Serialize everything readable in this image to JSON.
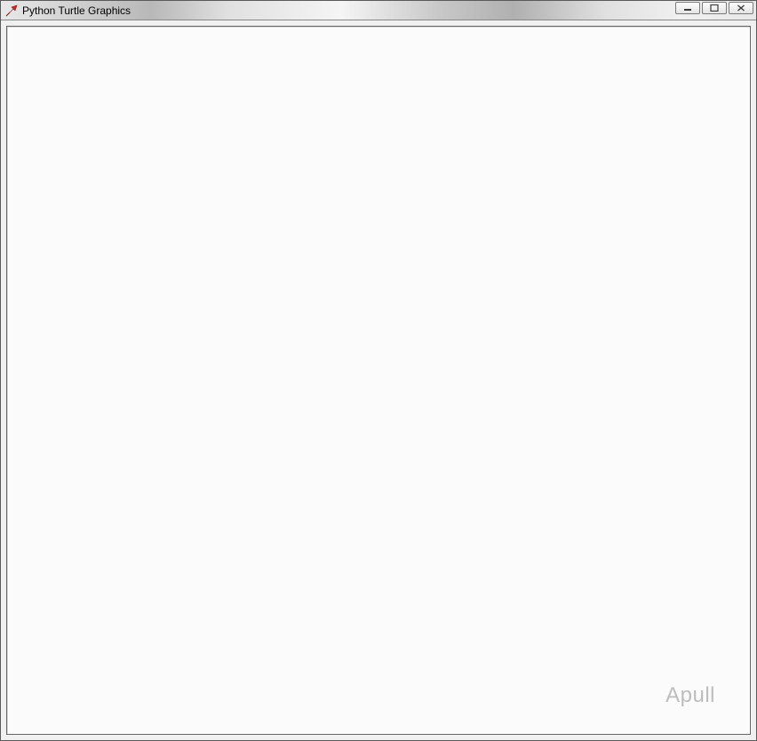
{
  "window": {
    "title": "Python Turtle Graphics"
  },
  "controls": {
    "minimize": "minimize",
    "maximize": "maximize",
    "close": "close"
  },
  "canvas": {
    "watermark": "Apull"
  }
}
